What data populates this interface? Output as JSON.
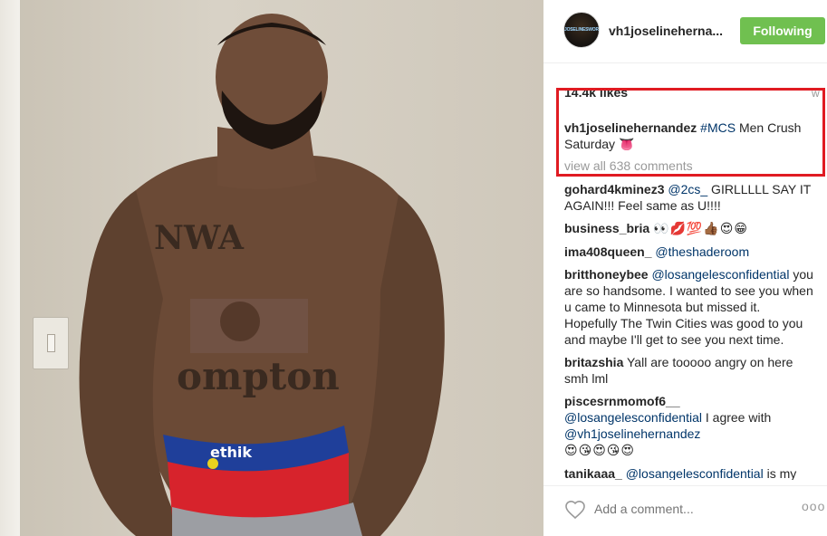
{
  "post": {
    "photo_alt": "tattooed man posing shirtless",
    "username": "vh1joselinehernandez",
    "username_display": "vh1joselinehernа...",
    "avatar_text": "JOSELINESWORLD",
    "follow_label": "Following",
    "likes": "14.4k likes",
    "likes_right": "w",
    "caption": {
      "user": "vh1joselinehernandez",
      "hashtag": "#MCS",
      "text": " Men Crush Saturday ",
      "emoji": "👅"
    },
    "view_all": "view all 638 comments"
  },
  "comments": [
    {
      "user": "gohard4kminez3",
      "mention": "@2cs_",
      "text": " GIRLLLLL SAY IT AGAIN!!! Feel same as U!!!!",
      "emoji": ""
    },
    {
      "user": "business_bria",
      "mention": "",
      "text": " ",
      "emoji": "👀💋💯👍🏾😍😁"
    },
    {
      "user": "ima408queen_",
      "mention": "@theshaderoom",
      "text": "",
      "emoji": ""
    },
    {
      "user": "britthoneybee",
      "mention": "@losangelesconfidential",
      "text": " you are so handsome. I wanted to see you when u came to Minnesota but missed it. Hopefully The Twin Cities was good to you and maybe I'll get to see you next time.",
      "emoji": ""
    },
    {
      "user": "britazshia",
      "mention": "",
      "text": " Yall are tooooo angry on here smh lml",
      "emoji": ""
    },
    {
      "user": "piscesrnmomof6__",
      "mention": "@losangelesconfidential",
      "text": " I agree with ",
      "mention2": "@vh1joselinehernandez",
      "emoji": "😍😘😍😘😍"
    },
    {
      "user": "tanikaaa_",
      "mention": "@losangelesconfidential",
      "text": " is my",
      "emoji": ""
    }
  ],
  "footer": {
    "placeholder": "Add a comment...",
    "more": "ooo"
  }
}
